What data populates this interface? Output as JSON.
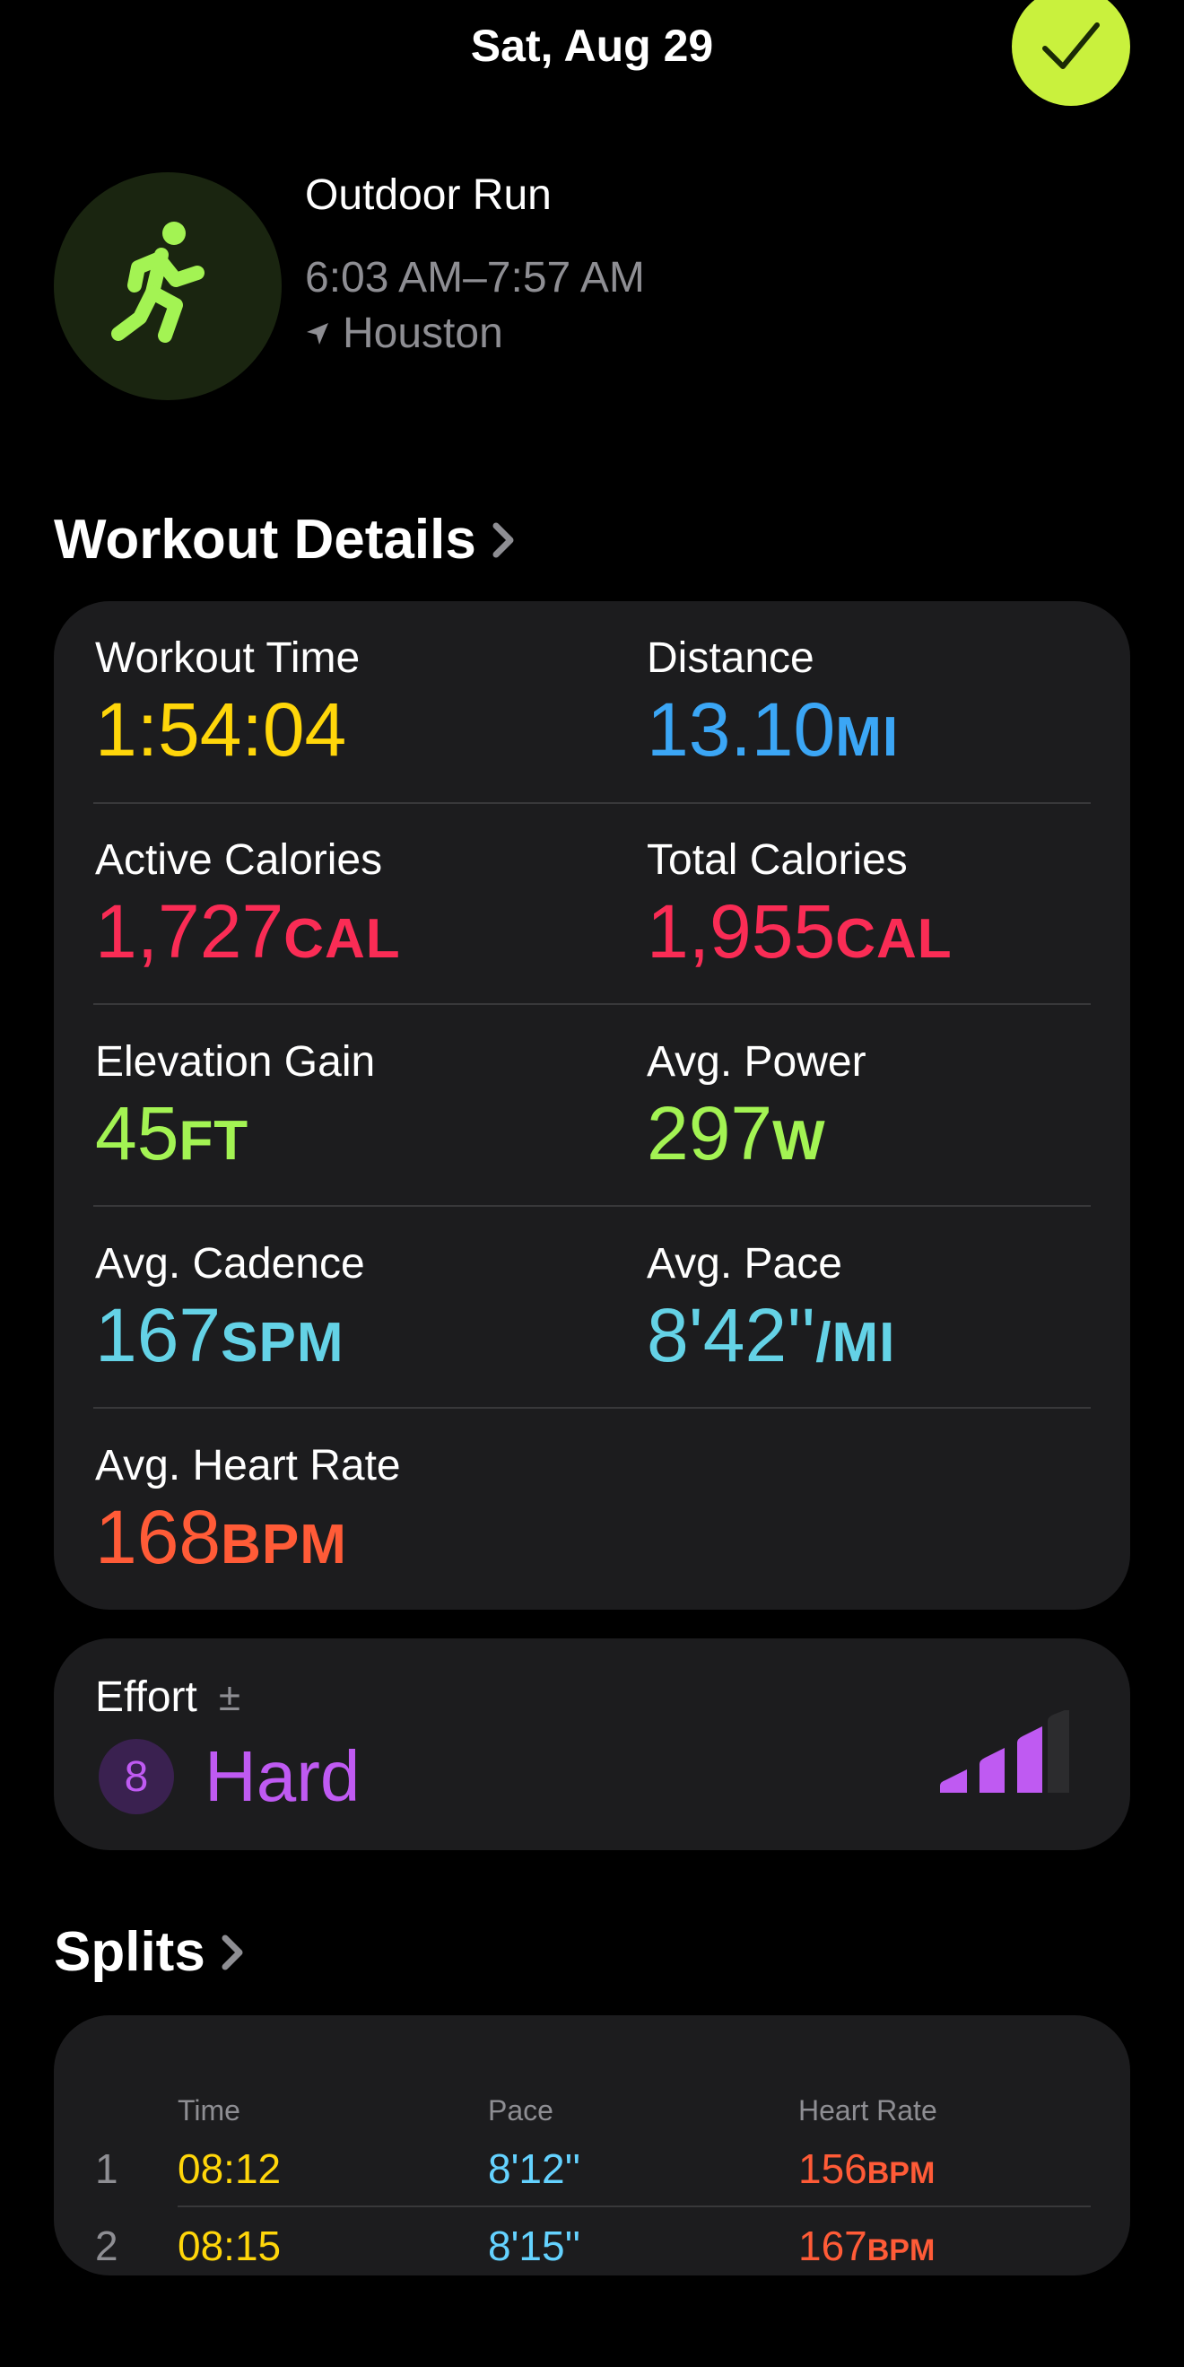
{
  "header": {
    "date": "Sat, Aug 29",
    "done_icon": "checkmark-icon"
  },
  "workout": {
    "name": "Outdoor Run",
    "time_range": "6:03 AM–7:57 AM",
    "location": "Houston",
    "icon": "running-figure-icon"
  },
  "details": {
    "title": "Workout Details",
    "metrics": [
      {
        "label": "Workout Time",
        "value": "1:54:04",
        "unit": "",
        "color": "#ffd60a"
      },
      {
        "label": "Distance",
        "value": "13.10",
        "unit": "MI",
        "color": "#3ba6f5"
      },
      {
        "label": "Active Calories",
        "value": "1,727",
        "unit": "CAL",
        "color": "#fa2c55"
      },
      {
        "label": "Total Calories",
        "value": "1,955",
        "unit": "CAL",
        "color": "#fa2c55"
      },
      {
        "label": "Elevation Gain",
        "value": "45",
        "unit": "FT",
        "color": "#a3f353"
      },
      {
        "label": "Avg. Power",
        "value": "297",
        "unit": "W",
        "color": "#a3f353"
      },
      {
        "label": "Avg. Cadence",
        "value": "167",
        "unit": "SPM",
        "color": "#64d2e6"
      },
      {
        "label": "Avg. Pace",
        "value": "8'42''",
        "unit": "/MI",
        "color": "#64d2e6"
      },
      {
        "label": "Avg. Heart Rate",
        "value": "168",
        "unit": "BPM",
        "color": "#ff5b37"
      }
    ]
  },
  "effort": {
    "label": "Effort",
    "adjust_symbol": "±",
    "score": "8",
    "text": "Hard",
    "level_fraction": 0.8
  },
  "splits": {
    "title": "Splits",
    "columns": [
      "Time",
      "Pace",
      "Heart Rate"
    ],
    "rows": [
      {
        "index": "1",
        "time": "08:12",
        "pace": "8'12''",
        "hr": "156",
        "hr_unit": "BPM"
      },
      {
        "index": "2",
        "time": "08:15",
        "pace": "8'15''",
        "hr": "167",
        "hr_unit": "BPM"
      }
    ]
  }
}
